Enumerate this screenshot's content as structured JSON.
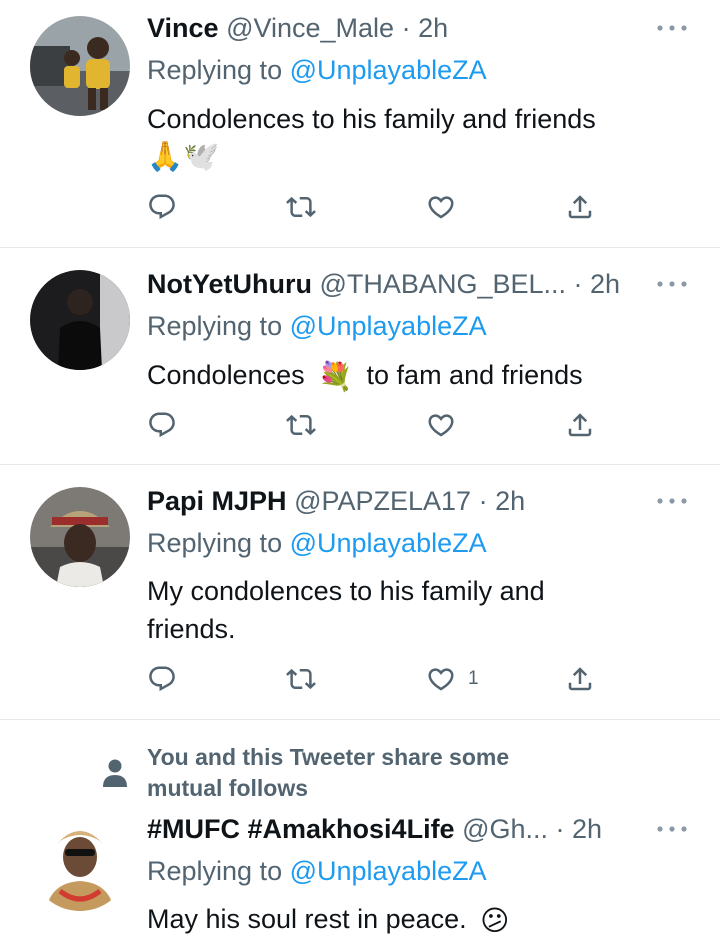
{
  "tweets": [
    {
      "name": "Vince",
      "handle": "@Vince_Male",
      "time": "2h",
      "replying_prefix": "Replying to ",
      "replying_to": "@UnplayableZA",
      "text_line1": "Condolences to his family and friends",
      "emojis": "🙏🕊️",
      "like_count": ""
    },
    {
      "name": "NotYetUhuru",
      "handle": "@THABANG_BEL...",
      "time": "2h",
      "replying_prefix": "Replying to ",
      "replying_to": "@UnplayableZA",
      "text_before": "Condolences",
      "emoji": "💐",
      "text_after": "to fam and friends",
      "like_count": ""
    },
    {
      "name": "Papi MJPH",
      "handle": "@PAPZELA17",
      "time": "2h",
      "replying_prefix": "Replying to ",
      "replying_to": "@UnplayableZA",
      "text_line1": "My condolences to his family and",
      "text_line2": "friends.",
      "like_count": "1"
    },
    {
      "social_context_line1": "You and this Tweeter share some",
      "social_context_line2": "mutual follows",
      "name": "#MUFC #Amakhosi4Life",
      "handle": "@Gh...",
      "time": "2h",
      "replying_prefix": "Replying to ",
      "replying_to": "@UnplayableZA",
      "text_line1": "May his soul rest in peace.",
      "emoji": "😕"
    }
  ],
  "separator": " · ",
  "icons": [
    "reply-icon",
    "retweet-icon",
    "like-icon",
    "share-icon",
    "more-icon",
    "person-icon"
  ],
  "colors": {
    "text": "#0f1419",
    "secondary": "#536471",
    "link": "#1d9bf0",
    "divider": "#e6e9ec"
  }
}
